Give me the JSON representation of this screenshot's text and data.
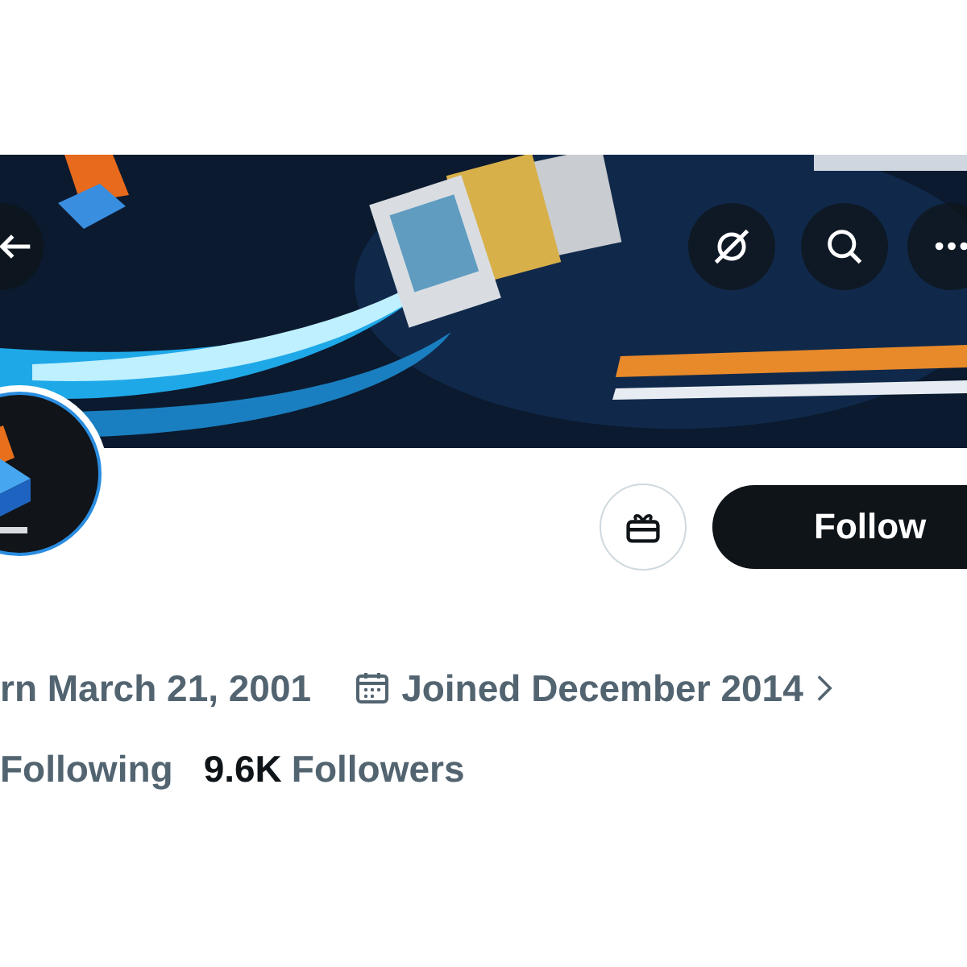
{
  "profile": {
    "follow_button": "Follow",
    "birth_date": "rn March 21, 2001",
    "joined": "Joined December 2014",
    "following_label": "Following",
    "followers_count": "9.6K",
    "followers_label": "Followers"
  }
}
